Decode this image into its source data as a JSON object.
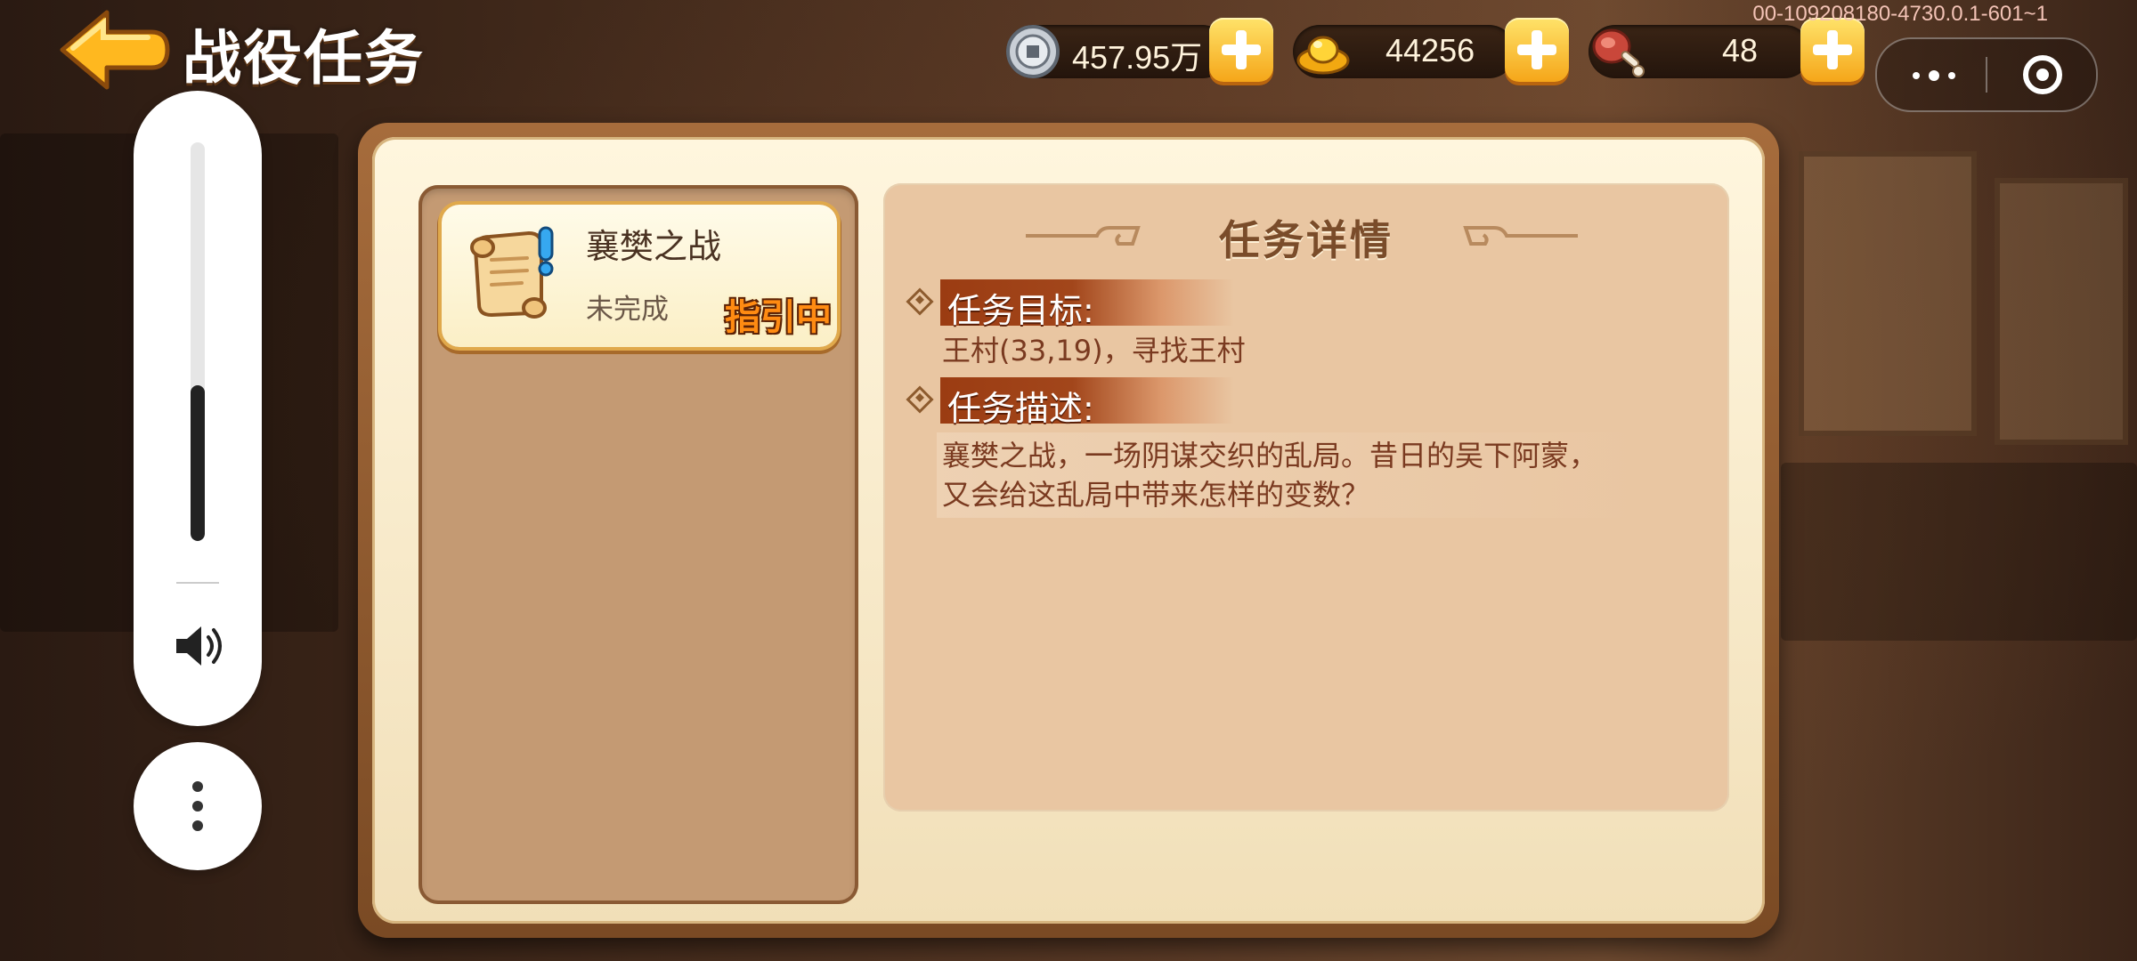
{
  "header": {
    "title": "战役任务",
    "debug_id": "00-109208180-4730.0.1-601~1"
  },
  "currency": [
    {
      "icon": "coin-icon",
      "value": "457.95万"
    },
    {
      "icon": "gold-ingot-icon",
      "value": "44256"
    },
    {
      "icon": "meat-drumstick-icon",
      "value": "48"
    }
  ],
  "quest_list": {
    "items": [
      {
        "name": "襄樊之战",
        "status": "未完成",
        "badge": "指引中"
      }
    ]
  },
  "detail": {
    "title": "任务详情",
    "objective_label": "任务目标:",
    "objective_text": "王村(33,19)，寻找王村",
    "description_label": "任务描述:",
    "description_line1": "襄樊之战，一场阴谋交织的乱局。昔日的吴下阿蒙，",
    "description_line2": "又会给这乱局中带来怎样的变数？"
  },
  "volume": {
    "level": 0.39
  },
  "colors": {
    "accent_orange": "#f5a619",
    "section_red": "#9b3c12",
    "parchment": "#fff6de"
  }
}
